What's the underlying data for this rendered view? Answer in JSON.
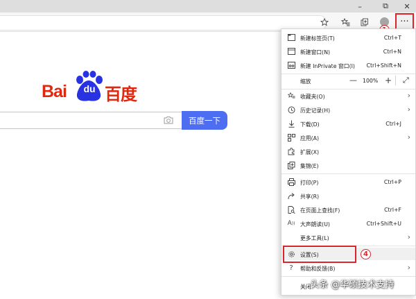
{
  "window": {
    "minimize": "–",
    "restore": "⧉",
    "close": "✕"
  },
  "toolbar": {
    "favorite_icon": "star-icon",
    "favorites_icon": "favorites-list-icon",
    "collections_icon": "collections-icon",
    "more_label": "···"
  },
  "annotations": {
    "step1": "1",
    "step4": "4"
  },
  "baidu": {
    "logo_bai": "Bai",
    "logo_du": "du",
    "logo_cn": "百度",
    "search_button": "百度一下",
    "search_value": ""
  },
  "menu": {
    "new_tab": {
      "label": "新建标签页(T)",
      "shortcut": "Ctrl+T"
    },
    "new_window": {
      "label": "新建窗口(N)",
      "shortcut": "Ctrl+N"
    },
    "new_inprivate": {
      "label": "新建 InPrivate 窗口(I)",
      "shortcut": "Ctrl+Shift+N"
    },
    "zoom": {
      "label": "缩放",
      "minus": "—",
      "value": "100%",
      "plus": "+",
      "fullscreen": "⤢"
    },
    "favorites": {
      "label": "收藏夹(O)"
    },
    "history": {
      "label": "历史记录(H)"
    },
    "downloads": {
      "label": "下载(D)",
      "shortcut": "Ctrl+J"
    },
    "apps": {
      "label": "应用(A)"
    },
    "extensions": {
      "label": "扩展(X)"
    },
    "collections": {
      "label": "集锦(E)"
    },
    "print": {
      "label": "打印(P)",
      "shortcut": "Ctrl+P"
    },
    "share": {
      "label": "共享(R)"
    },
    "find": {
      "label": "在页面上查找(F)",
      "shortcut": "Ctrl+F"
    },
    "read_aloud": {
      "label": "大声朗读(U)",
      "shortcut": "Ctrl+Shift+U"
    },
    "more_tools": {
      "label": "更多工具(L)"
    },
    "settings": {
      "label": "设置(S)"
    },
    "help": {
      "label": "帮助和反馈(B)"
    },
    "close": {
      "label": "关闭"
    }
  },
  "watermark": "头条 @华硕技术支持",
  "colors": {
    "accent_red": "#d8252c",
    "baidu_blue": "#4e6ef2",
    "baidu_red": "#de2910"
  }
}
